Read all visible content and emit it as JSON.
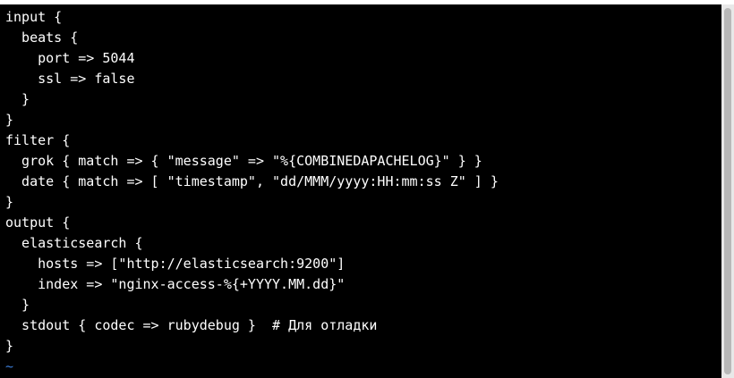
{
  "editor": {
    "lines": [
      "input {",
      "  beats {",
      "    port => 5044",
      "    ssl => false",
      "  }",
      "}",
      "filter {",
      "  grok { match => { \"message\" => \"%{COMBINEDAPACHELOG}\" } }",
      "  date { match => [ \"timestamp\", \"dd/MMM/yyyy:HH:mm:ss Z\" ] }",
      "}",
      "output {",
      "  elasticsearch {",
      "    hosts => [\"http://elasticsearch:9200\"]",
      "    index => \"nginx-access-%{+YYYY.MM.dd}\"",
      "  }",
      "  stdout { codec => rubydebug }  # Для отладки",
      "}"
    ],
    "empty_line_marker": "~"
  },
  "colors": {
    "background": "#000000",
    "text": "#ffffff",
    "tilde": "#3a7bd5"
  }
}
